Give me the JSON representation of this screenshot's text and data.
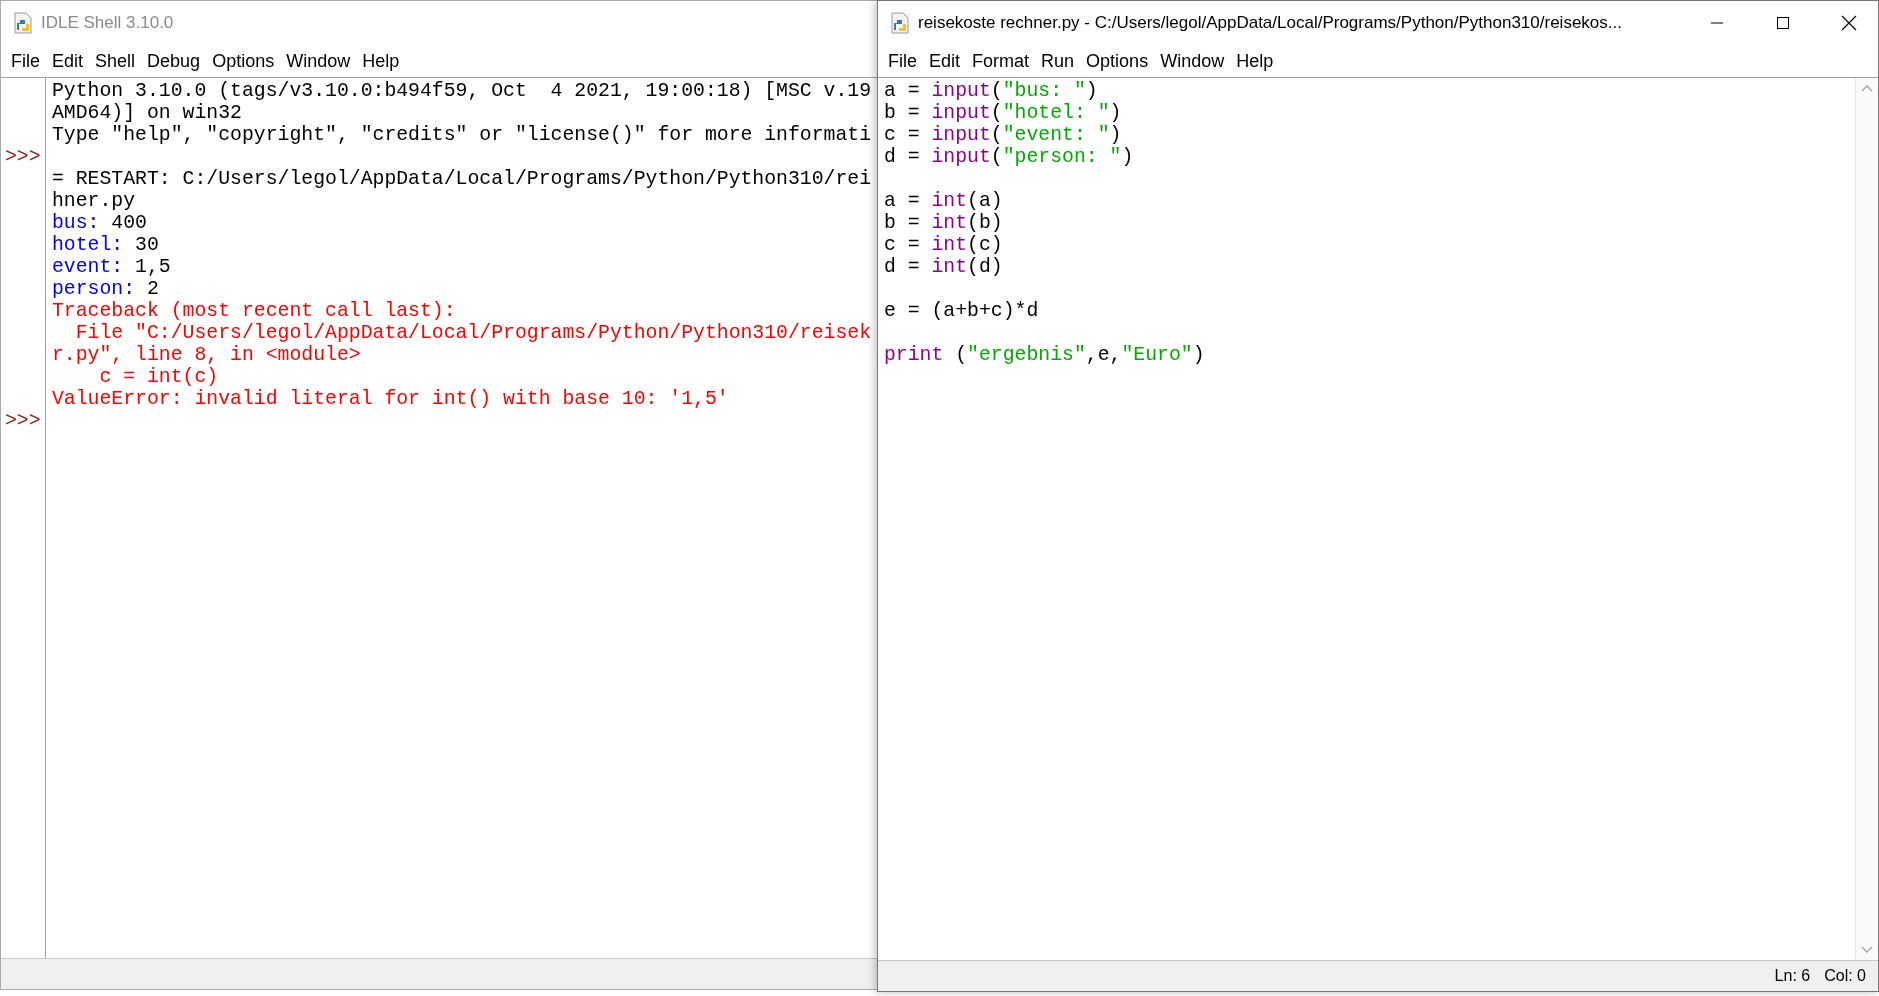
{
  "shell_window": {
    "title": "IDLE Shell 3.10.0",
    "active": false,
    "menu": [
      "File",
      "Edit",
      "Shell",
      "Debug",
      "Options",
      "Window",
      "Help"
    ],
    "lines": [
      {
        "segments": [
          {
            "kind": "banner",
            "text": "Python 3.10.0 (tags/v3.10.0:b494f59, Oct  4 2021, 19:00:18) [MSC v.19"
          }
        ]
      },
      {
        "segments": [
          {
            "kind": "banner",
            "text": "AMD64)] on win32"
          }
        ]
      },
      {
        "segments": [
          {
            "kind": "banner",
            "text": "Type \"help\", \"copyright\", \"credits\" or \"license()\" for more informati"
          }
        ]
      },
      {
        "prompt": ">>>"
      },
      {
        "segments": [
          {
            "kind": "banner",
            "text": "= RESTART: C:/Users/legol/AppData/Local/Programs/Python/Python310/rei"
          }
        ]
      },
      {
        "segments": [
          {
            "kind": "banner",
            "text": "hner.py"
          }
        ]
      },
      {
        "segments": [
          {
            "kind": "stdout",
            "text": "bus: "
          },
          {
            "kind": "stdin",
            "text": "400"
          }
        ]
      },
      {
        "segments": [
          {
            "kind": "stdout",
            "text": "hotel: "
          },
          {
            "kind": "stdin",
            "text": "30"
          }
        ]
      },
      {
        "segments": [
          {
            "kind": "stdout",
            "text": "event: "
          },
          {
            "kind": "stdin",
            "text": "1,5"
          }
        ]
      },
      {
        "segments": [
          {
            "kind": "stdout",
            "text": "person: "
          },
          {
            "kind": "stdin",
            "text": "2"
          }
        ]
      },
      {
        "segments": [
          {
            "kind": "error",
            "text": "Traceback (most recent call last):"
          }
        ]
      },
      {
        "segments": [
          {
            "kind": "error",
            "text": "  File \"C:/Users/legol/AppData/Local/Programs/Python/Python310/reisek"
          }
        ]
      },
      {
        "segments": [
          {
            "kind": "error",
            "text": "r.py\", line 8, in <module>"
          }
        ]
      },
      {
        "segments": [
          {
            "kind": "error",
            "text": "    c = int(c)"
          }
        ]
      },
      {
        "segments": [
          {
            "kind": "error",
            "text": "ValueError: invalid literal for int() with base 10: '1,5'"
          }
        ]
      },
      {
        "prompt": ">>>"
      }
    ]
  },
  "editor_window": {
    "title": "reisekoste rechner.py - C:/Users/legol/AppData/Local/Programs/Python/Python310/reisekos...",
    "active": true,
    "menu": [
      "File",
      "Edit",
      "Format",
      "Run",
      "Options",
      "Window",
      "Help"
    ],
    "lines": [
      {
        "kind": "code",
        "segments": [
          {
            "kind": "plain",
            "text": "a = "
          },
          {
            "kind": "builtin",
            "text": "input"
          },
          {
            "kind": "plain",
            "text": "("
          },
          {
            "kind": "string",
            "text": "\"bus: \""
          },
          {
            "kind": "plain",
            "text": ")"
          }
        ]
      },
      {
        "kind": "code",
        "segments": [
          {
            "kind": "plain",
            "text": "b = "
          },
          {
            "kind": "builtin",
            "text": "input"
          },
          {
            "kind": "plain",
            "text": "("
          },
          {
            "kind": "string",
            "text": "\"hotel: \""
          },
          {
            "kind": "plain",
            "text": ")"
          }
        ]
      },
      {
        "kind": "code",
        "segments": [
          {
            "kind": "plain",
            "text": "c = "
          },
          {
            "kind": "builtin",
            "text": "input"
          },
          {
            "kind": "plain",
            "text": "("
          },
          {
            "kind": "string",
            "text": "\"event: \""
          },
          {
            "kind": "plain",
            "text": ")"
          }
        ]
      },
      {
        "kind": "code",
        "segments": [
          {
            "kind": "plain",
            "text": "d = "
          },
          {
            "kind": "builtin",
            "text": "input"
          },
          {
            "kind": "plain",
            "text": "("
          },
          {
            "kind": "string",
            "text": "\"person: \""
          },
          {
            "kind": "plain",
            "text": ")"
          }
        ]
      },
      {
        "kind": "blank"
      },
      {
        "kind": "code",
        "segments": [
          {
            "kind": "plain",
            "text": "a = "
          },
          {
            "kind": "builtin",
            "text": "int"
          },
          {
            "kind": "plain",
            "text": "(a)"
          }
        ]
      },
      {
        "kind": "code",
        "segments": [
          {
            "kind": "plain",
            "text": "b = "
          },
          {
            "kind": "builtin",
            "text": "int"
          },
          {
            "kind": "plain",
            "text": "(b)"
          }
        ]
      },
      {
        "kind": "code",
        "segments": [
          {
            "kind": "plain",
            "text": "c = "
          },
          {
            "kind": "builtin",
            "text": "int"
          },
          {
            "kind": "plain",
            "text": "(c)"
          }
        ]
      },
      {
        "kind": "code",
        "segments": [
          {
            "kind": "plain",
            "text": "d = "
          },
          {
            "kind": "builtin",
            "text": "int"
          },
          {
            "kind": "plain",
            "text": "(d)"
          }
        ]
      },
      {
        "kind": "blank"
      },
      {
        "kind": "code",
        "segments": [
          {
            "kind": "plain",
            "text": "e = (a+b+c)*d"
          }
        ]
      },
      {
        "kind": "blank"
      },
      {
        "kind": "code",
        "segments": [
          {
            "kind": "builtin",
            "text": "print"
          },
          {
            "kind": "plain",
            "text": " ("
          },
          {
            "kind": "string",
            "text": "\"ergebnis\""
          },
          {
            "kind": "plain",
            "text": ",e,"
          },
          {
            "kind": "string",
            "text": "\"Euro\""
          },
          {
            "kind": "plain",
            "text": ")"
          }
        ]
      }
    ],
    "status": [
      "Ln: 6",
      "Col: 0"
    ]
  }
}
